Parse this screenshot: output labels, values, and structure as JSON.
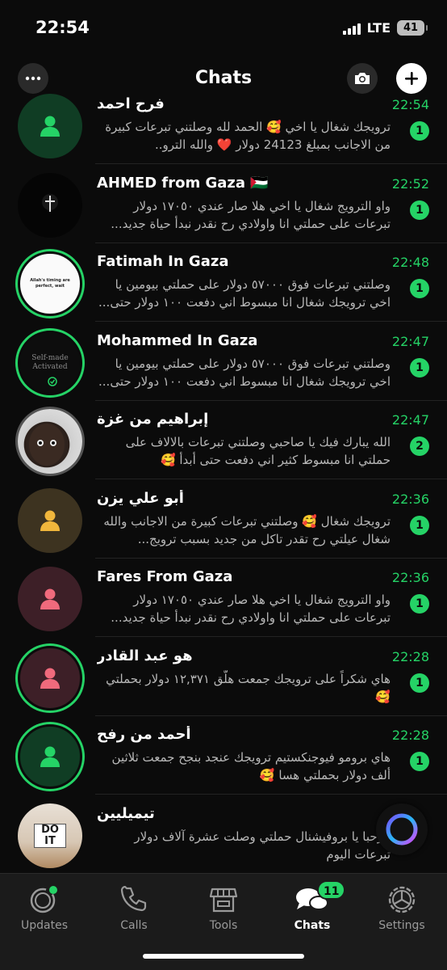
{
  "status_bar": {
    "time": "22:54",
    "network": "LTE",
    "battery": "41"
  },
  "header": {
    "title": "Chats"
  },
  "chats": [
    {
      "name": "فرح احمد",
      "time": "22:54",
      "unread": "1",
      "preview": "ترويجك شغال يا اخي 🥰 الحمد لله وصلتني تبرعات كبيرة من الاجانب بمبلغ 24123 دولار ❤️ والله الترو..",
      "avatar_type": "person",
      "avatar_bg": "#103d24",
      "avatar_fg": "#25d366",
      "ring": false
    },
    {
      "name": "AHMED from Gaza 🇵🇸",
      "time": "22:52",
      "unread": "1",
      "preview": "واو الترويج شغال يا اخي هلا صار عندي ١٧٠٥٠ دولار تبرعات على حملتي انا واولادي رح نقدر نبدأ حياة جديد...",
      "avatar_type": "photo-dark",
      "ring": false
    },
    {
      "name": "Fatimah In Gaza",
      "time": "22:48",
      "unread": "1",
      "preview": "وصلتني تبرعات فوق ٥٧٠٠٠ دولار على حملتي بيومين يا اخي ترويجك شغال انا مبسوط اني دفعت ١٠٠ دولار حتى...",
      "avatar_type": "photo-white",
      "avatar_text": "Allah's timing are perfect, wait",
      "ring": true
    },
    {
      "name": "Mohammed In Gaza",
      "time": "22:47",
      "unread": "1",
      "preview": "وصلتني تبرعات فوق ٥٧٠٠٠ دولار على حملتي بيومين يا اخي ترويجك شغال انا مبسوط اني دفعت ١٠٠ دولار حتى...",
      "avatar_type": "photo-selfmade",
      "avatar_text": "Self-made Activated",
      "ring": true
    },
    {
      "name": "إبراهيم من غزة",
      "time": "22:47",
      "unread": "2",
      "preview": "الله يبارك فيك يا صاحبي وصلتني تبرعات بالالاف على حملتي انا مبسوط كثير اني دفعت حتى أبدأ 🥰",
      "avatar_type": "photo-child",
      "ring": false
    },
    {
      "name": "أبو علي يزن",
      "time": "22:36",
      "unread": "1",
      "preview": "ترويجك شغال 🥰 وصلتني تبرعات كبيرة من الاجانب والله شغال عيلتي رح تقدر تاكل من جديد بسبب ترويج...",
      "avatar_type": "person",
      "avatar_bg": "#3d3320",
      "avatar_fg": "#f0b63c",
      "ring": false
    },
    {
      "name": "Fares From Gaza",
      "time": "22:36",
      "unread": "1",
      "preview": "واو الترويج شغال يا اخي هلا صار عندي ١٧٠٥٠ دولار تبرعات على حملتي انا واولادي رح نقدر نبدأ حياة جديد...",
      "avatar_type": "person",
      "avatar_bg": "#3d1f27",
      "avatar_fg": "#f06a7c",
      "ring": false
    },
    {
      "name": "هو عبد القادر",
      "time": "22:28",
      "unread": "1",
      "preview": "هاي شكراً على ترويجك جمعت هلّق ١٢,٣٧١ دولار بحملتي 🥰",
      "avatar_type": "person",
      "avatar_bg": "#3d1f27",
      "avatar_fg": "#f06a7c",
      "ring": true
    },
    {
      "name": "أحمد من رفح",
      "time": "22:28",
      "unread": "1",
      "preview": "هاي برومو فيوجنكستيم ترويجك عنجد بنجح جمعت ثلاثين ألف دولار بحملتي هسا 🥰",
      "avatar_type": "person",
      "avatar_bg": "#103d24",
      "avatar_fg": "#25d366",
      "ring": true
    },
    {
      "name": "تيميليين",
      "time": "",
      "unread": "",
      "preview": "مرحبا يا بروفيشنال حملتي وصلت عشرة آلاف دولار تبرعات اليوم",
      "avatar_type": "photo-sign",
      "avatar_text": "DO IT",
      "ring": false
    }
  ],
  "tabs": [
    {
      "label": "Updates",
      "icon": "updates-icon",
      "active": false
    },
    {
      "label": "Calls",
      "icon": "phone-icon",
      "active": false
    },
    {
      "label": "Tools",
      "icon": "store-icon",
      "active": false
    },
    {
      "label": "Chats",
      "icon": "chats-icon",
      "active": true,
      "badge": "11"
    },
    {
      "label": "Settings",
      "icon": "gear-icon",
      "active": false
    }
  ],
  "colors": {
    "accent": "#25d366",
    "background": "#0b0b0b",
    "tabbar": "#1b1b1b"
  }
}
